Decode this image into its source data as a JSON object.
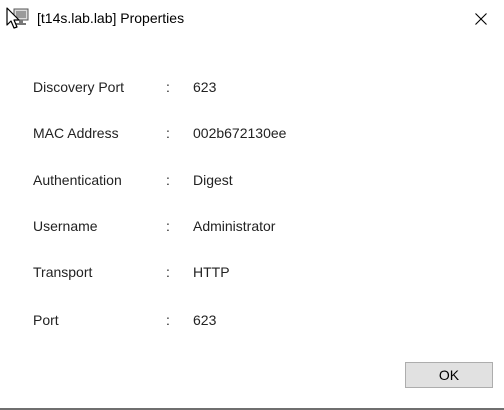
{
  "window": {
    "title": "[t14s.lab.lab] Properties",
    "icon": "computer-cursor-icon",
    "close_icon": "close-icon"
  },
  "properties": [
    {
      "label": "Discovery Port",
      "sep": ":",
      "value": "623"
    },
    {
      "label": "MAC Address",
      "sep": ":",
      "value": "002b672130ee"
    },
    {
      "label": "Authentication",
      "sep": ":",
      "value": "Digest"
    },
    {
      "label": "Username",
      "sep": ":",
      "value": "Administrator"
    },
    {
      "label": "Transport",
      "sep": ":",
      "value": "HTTP"
    },
    {
      "label": "Port",
      "sep": ":",
      "value": "623"
    }
  ],
  "buttons": {
    "ok_label": "OK"
  },
  "colors": {
    "background": "#ffffff",
    "text": "#222222",
    "button_face": "#e1e1e1",
    "button_border": "#adadad"
  }
}
